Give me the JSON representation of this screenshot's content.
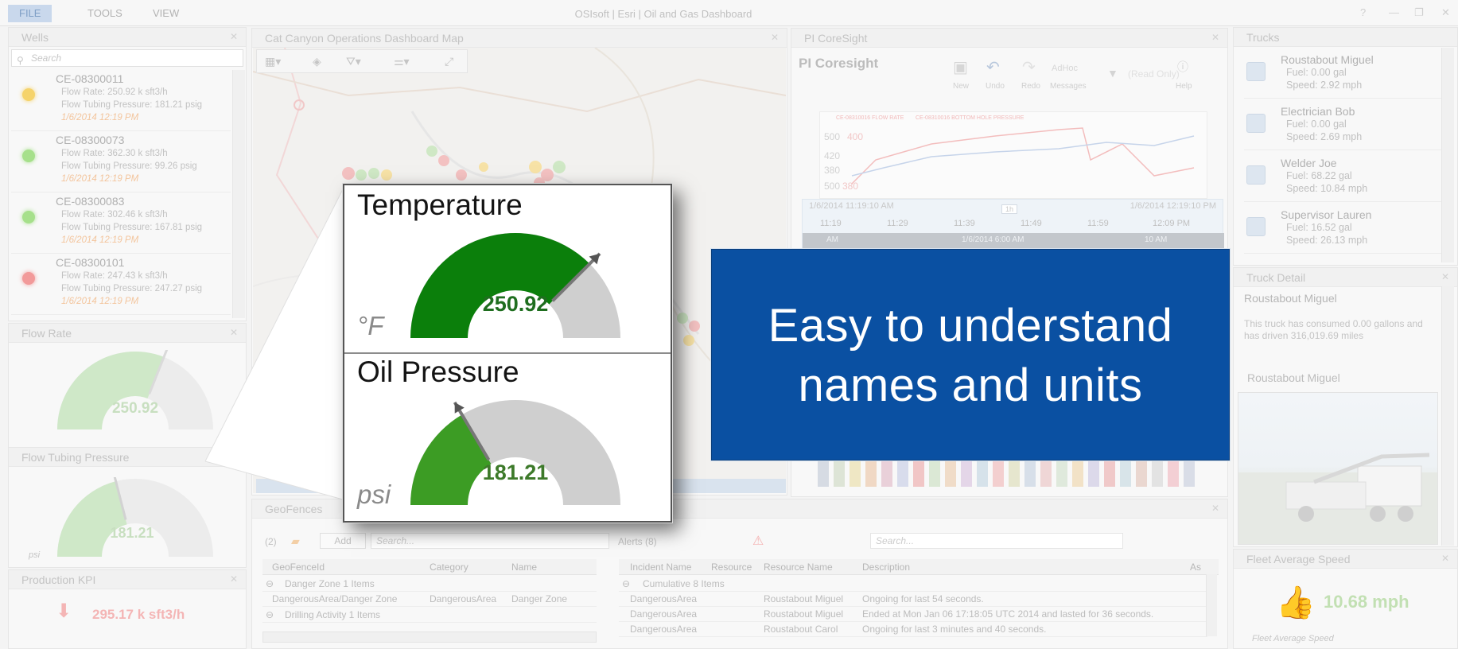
{
  "menubar": {
    "items": [
      "FILE",
      "TOOLS",
      "VIEW"
    ],
    "window_title": "OSIsoft | Esri | Oil and Gas Dashboard"
  },
  "wells": {
    "title": "Wells",
    "search_placeholder": "Search",
    "items": [
      {
        "id": "CE-08300011",
        "flow": "Flow Rate: 250.92 k sft3/h",
        "pressure": "Flow Tubing Pressure: 181.21 psig",
        "time": "1/6/2014 12:19 PM",
        "status_color": "#f5d36b"
      },
      {
        "id": "CE-08300073",
        "flow": "Flow Rate: 362.30 k sft3/h",
        "pressure": "Flow Tubing Pressure: 99.26 psig",
        "time": "1/6/2014 12:19 PM",
        "status_color": "#a6e08b"
      },
      {
        "id": "CE-08300083",
        "flow": "Flow Rate: 302.46 k sft3/h",
        "pressure": "Flow Tubing Pressure: 167.81 psig",
        "time": "1/6/2014 12:19 PM",
        "status_color": "#a6e08b"
      },
      {
        "id": "CE-08300101",
        "flow": "Flow Rate: 247.43 k sft3/h",
        "pressure": "Flow Tubing Pressure: 247.27 psig",
        "time": "1/6/2014 12:19 PM",
        "status_color": "#f29a9a"
      }
    ]
  },
  "flow_rate": {
    "title": "Flow Rate",
    "value": "250.92",
    "fill_fraction": 0.62
  },
  "tubing_pressure": {
    "title": "Flow Tubing Pressure",
    "value": "181.21",
    "unit": "psi",
    "fill_fraction": 0.42
  },
  "production_kpi": {
    "title": "Production KPI",
    "value": "295.17 k sft3/h"
  },
  "map": {
    "title": "Cat Canyon Operations Dashboard Map"
  },
  "coresight": {
    "title": "PI CoreSight",
    "logo": "PI Coresight",
    "tools": [
      "New",
      "Undo",
      "Redo",
      "Messages",
      "Help"
    ],
    "adhoc": "AdHoc",
    "readonly": "(Read Only)",
    "chart_legend": [
      "CE-08310016 FLOW RATE",
      "CE-08310016 BOTTOM HOLE PRESSURE"
    ],
    "y_ticks": [
      "500",
      "400",
      "420",
      "380",
      "500",
      "380"
    ],
    "time_start": "1/6/2014 11:19:10 AM",
    "time_end": "1/6/2014 12:19:10 PM",
    "span": "1h",
    "ticks": [
      "11:19",
      "11:29",
      "11:39",
      "11:49",
      "11:59",
      "12:09 PM"
    ],
    "range_left": "AM",
    "range_mid": "1/6/2014 6:00 AM",
    "range_right": "10 AM"
  },
  "trucks": {
    "title": "Trucks",
    "items": [
      {
        "name": "Roustabout Miguel",
        "fuel": "Fuel: 0.00 gal",
        "speed": "Speed: 2.92 mph"
      },
      {
        "name": "Electrician Bob",
        "fuel": "Fuel: 0.00 gal",
        "speed": "Speed: 2.69 mph"
      },
      {
        "name": "Welder Joe",
        "fuel": "Fuel: 68.22 gal",
        "speed": "Speed: 10.84 mph"
      },
      {
        "name": "Supervisor Lauren",
        "fuel": "Fuel: 16.52 gal",
        "speed": "Speed: 26.13 mph"
      }
    ]
  },
  "truck_detail": {
    "title": "Truck Detail",
    "name": "Roustabout Miguel",
    "description": "This truck has consumed 0.00 gallons and has driven 316,019.69 miles",
    "photo_label": "Roustabout Miguel"
  },
  "fleet_speed": {
    "title": "Fleet Average Speed",
    "value": "10.68 mph",
    "caption": "Fleet Average Speed"
  },
  "geofences": {
    "title": "GeoFences",
    "count": "(2)",
    "add_label": "Add",
    "search_placeholder": "Search...",
    "columns": [
      "GeoFenceId",
      "Category",
      "Name"
    ],
    "groups": [
      "Danger Zone 1 Items",
      "Drilling Activity 1 Items"
    ],
    "row": [
      "DangerousArea/Danger Zone",
      "DangerousArea",
      "Danger Zone"
    ]
  },
  "alerts": {
    "count_label": "Alerts (8)",
    "search_placeholder": "Search...",
    "columns": [
      "Incident Name",
      "Resource",
      "Resource Name",
      "Description",
      "As"
    ],
    "group": "Cumulative 8 Items",
    "rows": [
      [
        "DangerousArea",
        "",
        "Roustabout Miguel",
        "Ongoing for last 54 seconds."
      ],
      [
        "DangerousArea",
        "",
        "Roustabout Miguel",
        "Ended at Mon Jan 06 17:18:05 UTC 2014 and lasted for 36 seconds."
      ],
      [
        "DangerousArea",
        "",
        "Roustabout Carol",
        "Ongoing for last 3 minutes and 40 seconds."
      ]
    ]
  },
  "callout": {
    "temp_title": "Temperature",
    "temp_value": "250.92",
    "temp_unit": "°F",
    "temp_fill": 0.75,
    "oil_title": "Oil Pressure",
    "oil_value": "181.21",
    "oil_unit": "psi",
    "oil_fill": 0.33
  },
  "banner": {
    "line1": "Easy to understand",
    "line2": "names and units"
  },
  "colors": {
    "banner_bg": "#0a50a2",
    "gauge_green": "#0b7f0b",
    "gauge_green2": "#3c9c24",
    "gauge_grey": "#cfcfcf"
  }
}
